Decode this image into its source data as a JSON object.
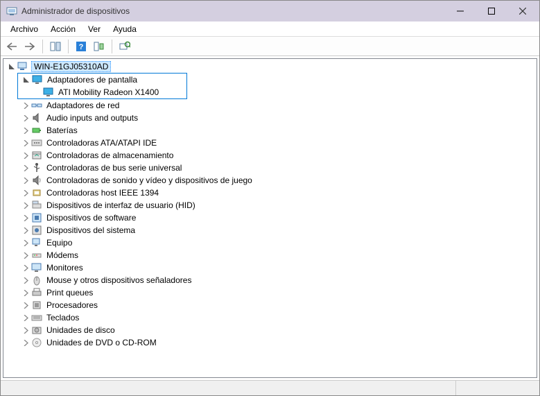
{
  "window": {
    "title": "Administrador de dispositivos"
  },
  "menu": {
    "file": "Archivo",
    "action": "Acción",
    "view": "Ver",
    "help": "Ayuda"
  },
  "toolbar": {
    "back": "back",
    "forward": "forward",
    "showhide": "showhide",
    "help": "help",
    "showhidden": "showhidden",
    "scan": "scan"
  },
  "tree": {
    "root": "WIN-E1GJ05310AD",
    "displayAdapters": {
      "label": "Adaptadores de pantalla",
      "child": "ATI Mobility Radeon X1400"
    },
    "items": [
      "Adaptadores de red",
      "Audio inputs and outputs",
      "Baterías",
      "Controladoras ATA/ATAPI IDE",
      "Controladoras de almacenamiento",
      "Controladoras de bus serie universal",
      "Controladoras de sonido y vídeo y dispositivos de juego",
      "Controladoras host IEEE 1394",
      "Dispositivos de interfaz de usuario (HID)",
      "Dispositivos de software",
      "Dispositivos del sistema",
      "Equipo",
      "Módems",
      "Monitores",
      "Mouse y otros dispositivos señaladores",
      "Print queues",
      "Procesadores",
      "Teclados",
      "Unidades de disco",
      "Unidades de DVD o CD-ROM"
    ]
  },
  "icons": {
    "computer": "computer",
    "display": "display",
    "network": "network",
    "audio": "audio",
    "battery": "battery",
    "ide": "ide",
    "storage": "storage",
    "usb": "usb",
    "sound": "sound",
    "ieee1394": "ieee1394",
    "hid": "hid",
    "software": "software",
    "system": "system",
    "pc": "pc",
    "modem": "modem",
    "monitor": "monitor",
    "mouse": "mouse",
    "printqueue": "printqueue",
    "cpu": "cpu",
    "keyboard": "keyboard",
    "disk": "disk",
    "dvd": "dvd"
  }
}
